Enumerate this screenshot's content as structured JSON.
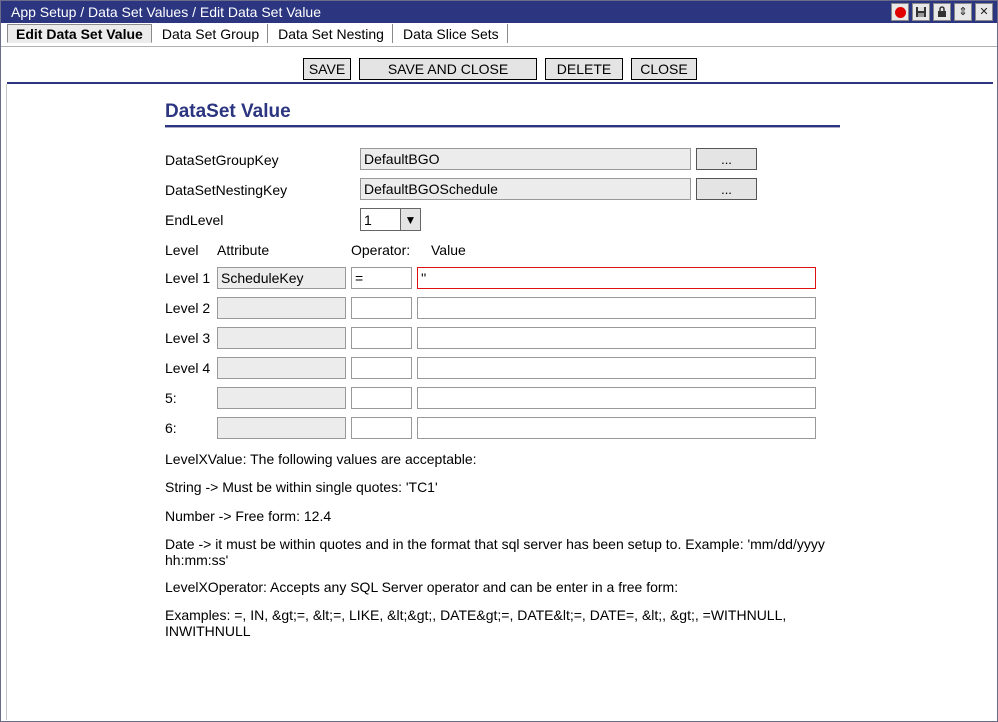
{
  "window": {
    "title": "App Setup / Data Set Values / Edit Data Set Value"
  },
  "tabs": [
    {
      "label": "Edit Data Set Value",
      "active": true
    },
    {
      "label": "Data Set Group",
      "active": false
    },
    {
      "label": "Data Set Nesting",
      "active": false
    },
    {
      "label": "Data Slice Sets",
      "active": false
    }
  ],
  "toolbar": {
    "save": "SAVE",
    "save_and_close": "SAVE AND CLOSE",
    "delete": "DELETE",
    "close": "CLOSE"
  },
  "form": {
    "section_title": "DataSet Value",
    "group_key_label": "DataSetGroupKey",
    "group_key_value": "DefaultBGO",
    "nesting_key_label": "DataSetNestingKey",
    "nesting_key_value": "DefaultBGOSchedule",
    "lookup_button": "...",
    "end_level_label": "EndLevel",
    "end_level_value": "1",
    "col_level": "Level",
    "col_attribute": "Attribute",
    "col_operator": "Operator:",
    "col_value": "Value",
    "levels": [
      {
        "label": "Level 1",
        "attribute": "ScheduleKey",
        "operator": "=",
        "value": "''"
      },
      {
        "label": "Level 2",
        "attribute": "",
        "operator": "",
        "value": ""
      },
      {
        "label": "Level 3",
        "attribute": "",
        "operator": "",
        "value": ""
      },
      {
        "label": "Level 4",
        "attribute": "",
        "operator": "",
        "value": ""
      },
      {
        "label": "5:",
        "attribute": "",
        "operator": "",
        "value": ""
      },
      {
        "label": "6:",
        "attribute": "",
        "operator": "",
        "value": ""
      }
    ]
  },
  "notes": {
    "line1": "LevelXValue: The following values are acceptable:",
    "line2": "String -> Must be within single quotes: 'TC1'",
    "line3": "Number -> Free form: 12.4",
    "line4": "Date -> it must be within quotes and in the format that sql server has been setup to. Example: 'mm/dd/yyyy hh:mm:ss'",
    "line5": "LevelXOperator: Accepts any SQL Server operator and can be enter in a free form:",
    "line6": "Examples: =, IN, &gt;=, &lt;=, LIKE, &lt;&gt;, DATE&gt;=, DATE&lt;=, DATE=, &lt;, &gt;, =WITHNULL, INWITHNULL"
  },
  "colors": {
    "accent": "#2b3580",
    "error_border": "#e01010"
  }
}
